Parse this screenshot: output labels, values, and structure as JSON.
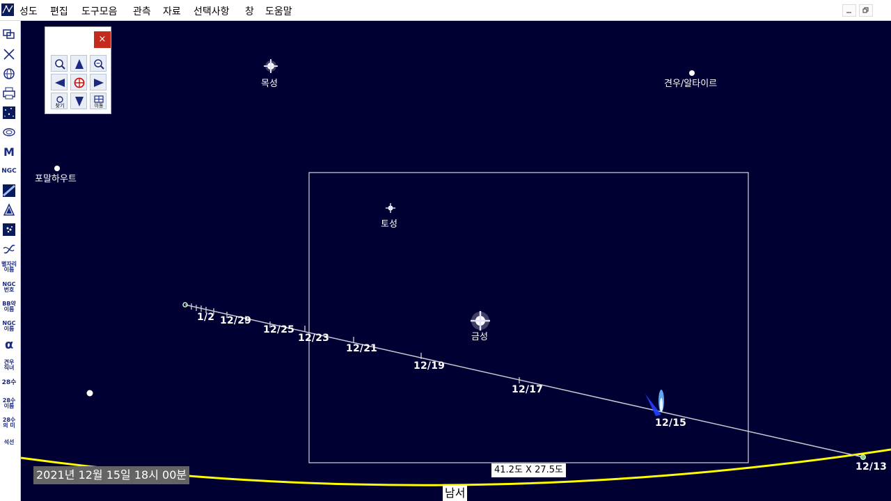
{
  "menu": [
    "성도",
    "편집",
    "도구모음",
    "관측",
    "자료",
    "선택사항",
    "창",
    "도움말"
  ],
  "window_controls": [
    "minimize-icon",
    "restore-icon"
  ],
  "toolbar": {
    "text_buttons": [
      "M",
      "NGC",
      "별자리 이름",
      "NGC 번호",
      "BB약 이름",
      "NGC 이름",
      "α",
      "견우 직녀",
      "28수",
      "28수 이름",
      "28수 의 미",
      "석선"
    ]
  },
  "nav_panel": {
    "close": "×",
    "buttons": [
      "zoom-in-icon",
      "pan-up-icon",
      "zoom-out-icon",
      "pan-left-icon",
      "center-target-icon",
      "pan-right-icon",
      "find-icon",
      "pan-down-icon",
      "move-icon"
    ],
    "find_label": "찾기",
    "move_label": "이동"
  },
  "sky": {
    "objects": {
      "jupiter": "목성",
      "altair": "견우/알타이르",
      "fomalhaut": "포말하우트",
      "saturn": "토성",
      "venus": "금성"
    },
    "comet_path_dates": [
      "1/2",
      "12/29",
      "12/25",
      "12/23",
      "12/21",
      "12/19",
      "12/17",
      "12/15",
      "12/13"
    ],
    "colors": {
      "background": "#000033",
      "horizon": "#ffff00",
      "path": "#c8c8d0",
      "comet": "#6fb8ff"
    }
  },
  "status": {
    "datetime": "2021년 12월 15일 18시 00분",
    "field_of_view": "41.2도 X 27.5도",
    "direction": "남서"
  }
}
